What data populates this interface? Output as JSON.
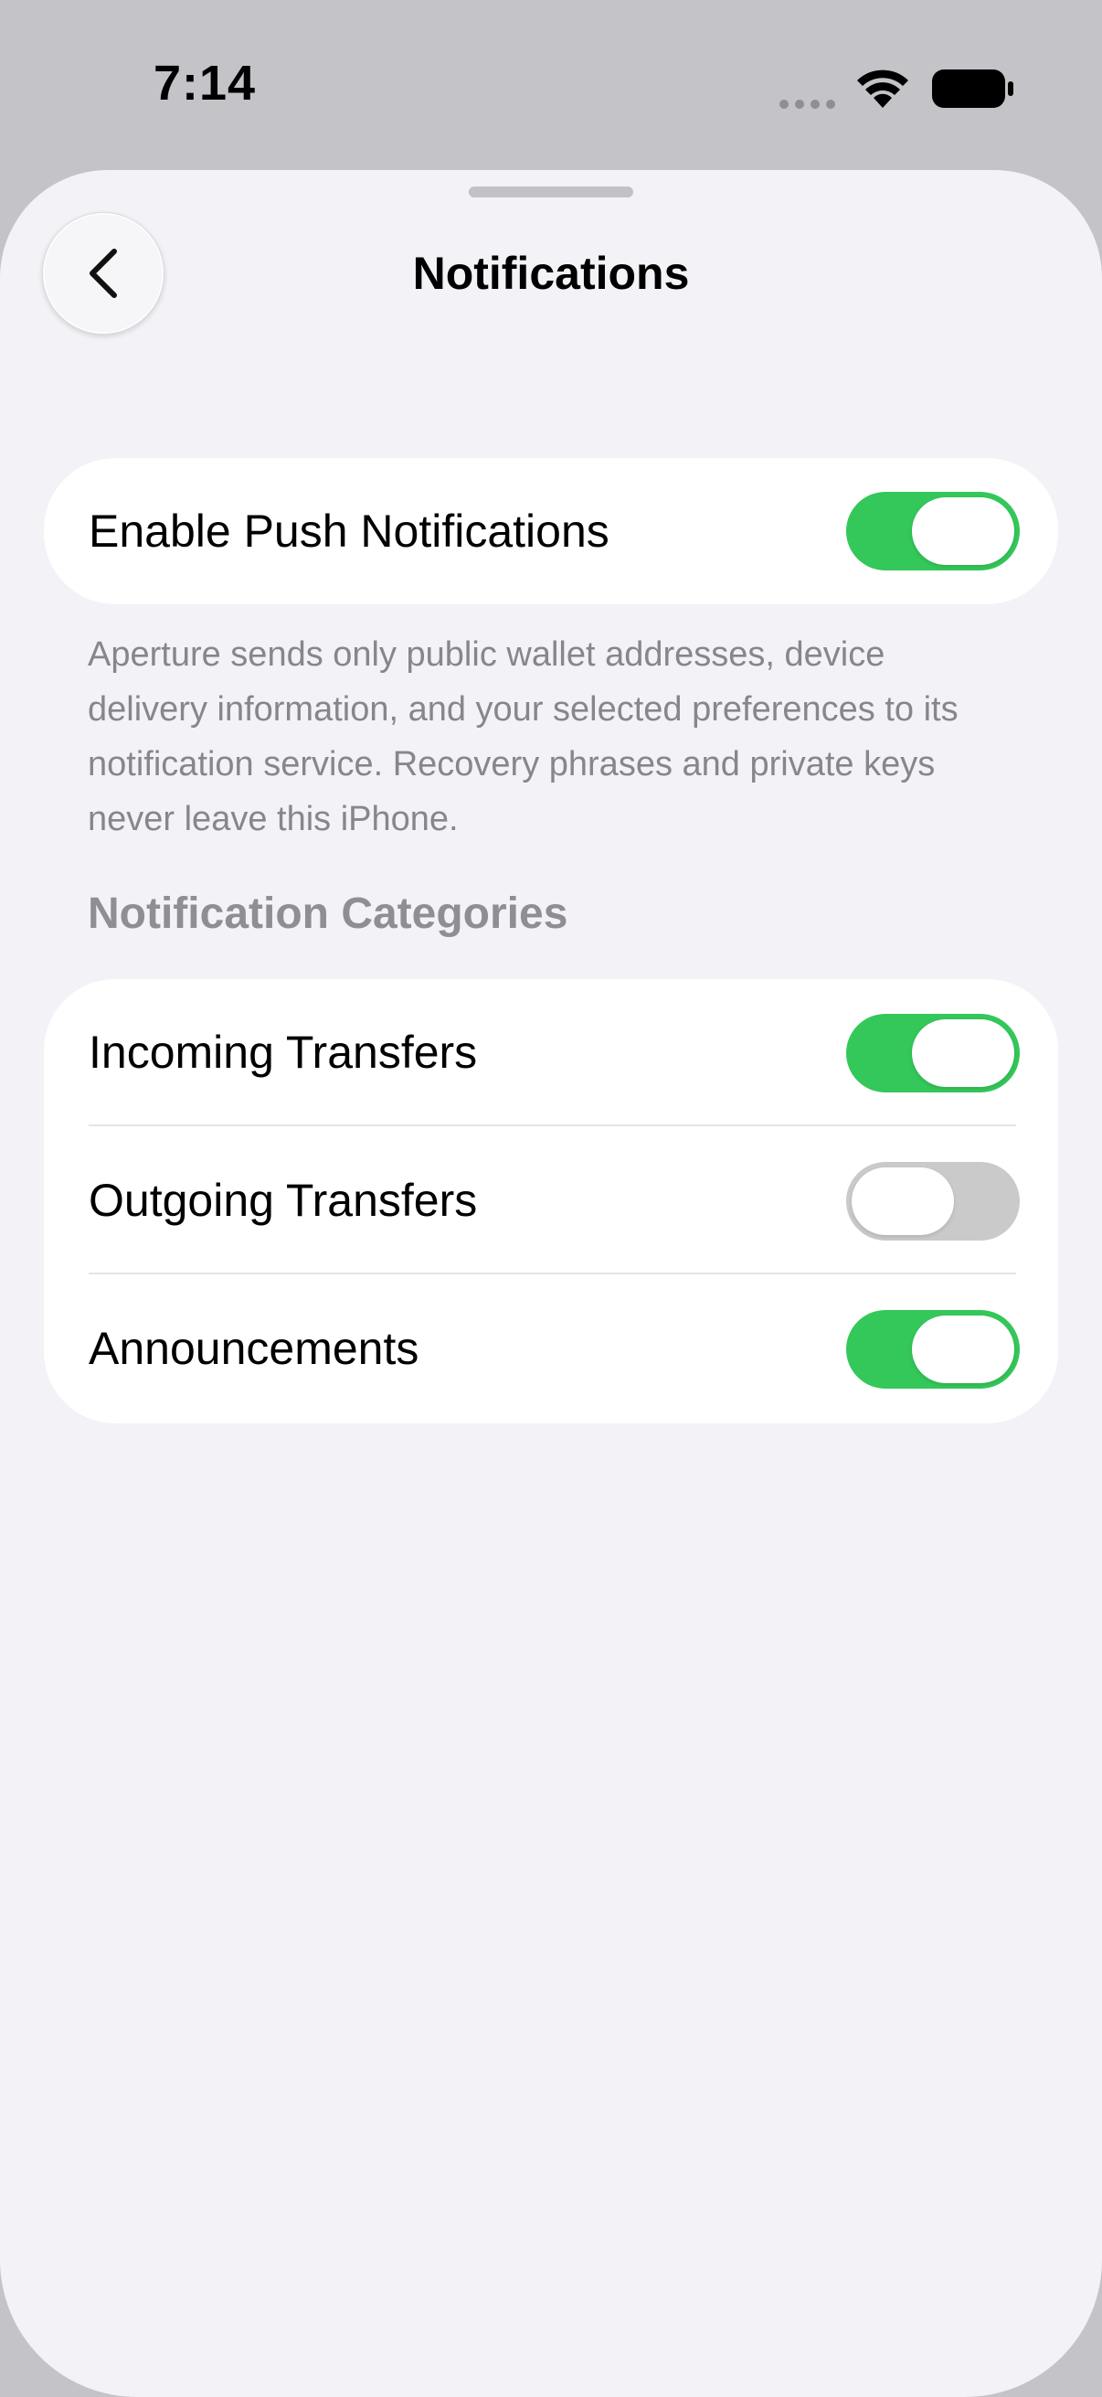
{
  "status_bar": {
    "time": "7:14",
    "icons": [
      "cellular-dots-icon",
      "wifi-icon",
      "battery-icon"
    ]
  },
  "nav": {
    "title": "Notifications",
    "back_icon": "chevron-left-icon"
  },
  "push": {
    "label": "Enable Push Notifications",
    "enabled": true
  },
  "footer_note": "Aperture sends only public wallet addresses, device delivery information, and your selected preferences to its notification service. Recovery phrases and private keys never leave this iPhone.",
  "categories": {
    "header": "Notification Categories",
    "items": [
      {
        "label": "Incoming Transfers",
        "enabled": true
      },
      {
        "label": "Outgoing Transfers",
        "enabled": false
      },
      {
        "label": "Announcements",
        "enabled": true
      }
    ]
  },
  "colors": {
    "toggle_on": "#34c759",
    "toggle_off": "#cacaca",
    "background": "#f2f2f7",
    "secondary_text": "#86868b"
  }
}
